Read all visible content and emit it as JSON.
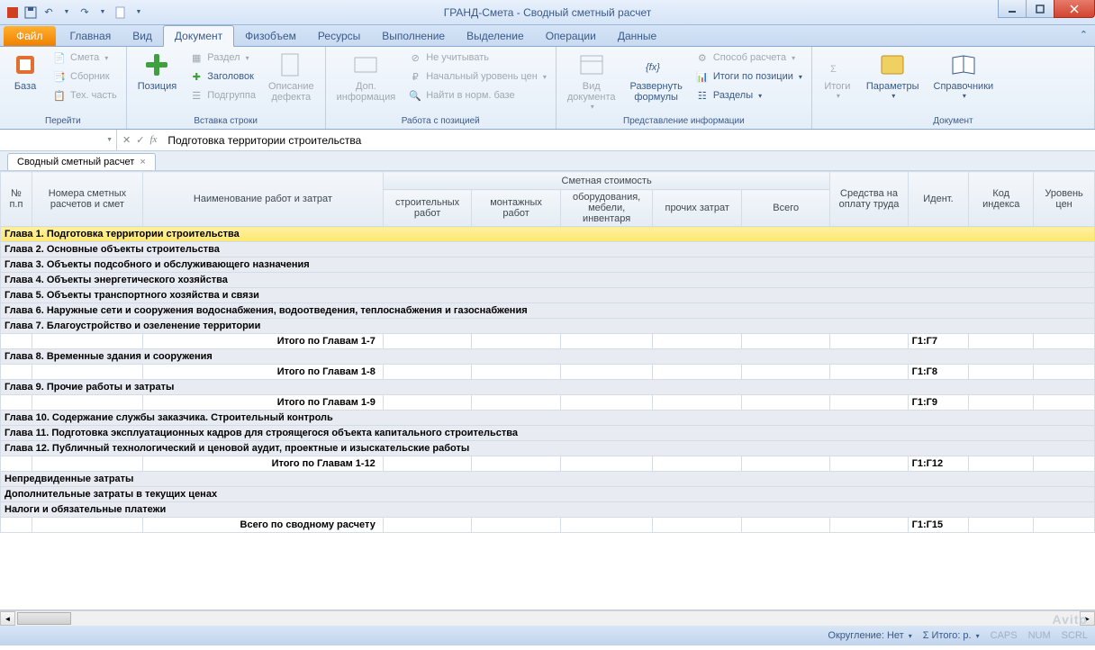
{
  "window": {
    "title": "ГРАНД-Смета - Сводный сметный расчет"
  },
  "qat": {
    "items": [
      "app",
      "save",
      "undo",
      "redo",
      "new",
      "dd"
    ]
  },
  "tabs": {
    "file": "Файл",
    "items": [
      "Главная",
      "Вид",
      "Документ",
      "Физобъем",
      "Ресурсы",
      "Выполнение",
      "Выделение",
      "Операции",
      "Данные"
    ],
    "active": 2
  },
  "ribbon": {
    "groups": [
      {
        "label": "Перейти",
        "big": [
          {
            "name": "baza",
            "label": "База"
          }
        ],
        "small": [
          {
            "name": "smeta",
            "label": "Смета",
            "dd": true,
            "disabled": true
          },
          {
            "name": "sbornik",
            "label": "Сборник",
            "disabled": true
          },
          {
            "name": "tehchast",
            "label": "Тех. часть",
            "disabled": true
          }
        ]
      },
      {
        "label": "Вставка строки",
        "big": [
          {
            "name": "pozitsiya",
            "label": "Позиция"
          }
        ],
        "small": [
          {
            "name": "razdel",
            "label": "Раздел",
            "dd": true,
            "disabled": true
          },
          {
            "name": "zagolovok",
            "label": "Заголовок"
          },
          {
            "name": "podgruppa",
            "label": "Подгруппа",
            "disabled": true
          }
        ],
        "big2": [
          {
            "name": "opisanie-defekta",
            "label": "Описание\nдефекта",
            "disabled": true
          }
        ]
      },
      {
        "label": "Работа с позицией",
        "big": [
          {
            "name": "dop-info",
            "label": "Доп.\nинформация",
            "disabled": true
          }
        ],
        "small": [
          {
            "name": "ne-uchityvat",
            "label": "Не учитывать",
            "disabled": true
          },
          {
            "name": "nach-uroven",
            "label": "Начальный уровень цен",
            "dd": true,
            "disabled": true
          },
          {
            "name": "naiti-v-baze",
            "label": "Найти в норм. базе",
            "disabled": true
          }
        ]
      },
      {
        "label": "Представление информации",
        "big": [
          {
            "name": "vid-dokumenta",
            "label": "Вид\nдокумента",
            "dd": true,
            "disabled": true
          },
          {
            "name": "razvernut",
            "label": "Развернуть\nформулы"
          }
        ],
        "small": [
          {
            "name": "sposob-rascheta",
            "label": "Способ расчета",
            "dd": true,
            "disabled": true
          },
          {
            "name": "itogi-po-pozitsii",
            "label": "Итоги по позиции",
            "dd": true
          },
          {
            "name": "razdely",
            "label": "Разделы",
            "dd": true
          }
        ]
      },
      {
        "label": "Документ",
        "big": [
          {
            "name": "itogi",
            "label": "Итоги",
            "dd": true,
            "disabled": true
          },
          {
            "name": "parametry",
            "label": "Параметры",
            "dd": true
          },
          {
            "name": "spravochniki",
            "label": "Справочники",
            "dd": true
          }
        ]
      }
    ]
  },
  "formula": {
    "value": "Подготовка территории строительства",
    "fx": "fx"
  },
  "ws_tab": {
    "label": "Сводный сметный расчет"
  },
  "columns": {
    "top": [
      "№\nп.п",
      "Номера сметных\nрасчетов и смет",
      "Наименование работ и затрат",
      "Сметная стоимость",
      "Средства на\nоплату труда",
      "Идент.",
      "Код\nиндекса",
      "Уровень\nцен"
    ],
    "sub": [
      "строительных\nработ",
      "монтажных работ",
      "оборудования,\nмебели, инвентаря",
      "прочих затрат",
      "Всего"
    ]
  },
  "rows": [
    {
      "type": "chapter",
      "selected": true,
      "text": "Глава 1. Подготовка территории строительства"
    },
    {
      "type": "chapter",
      "text": "Глава 2. Основные объекты строительства"
    },
    {
      "type": "chapter",
      "text": "Глава 3. Объекты подсобного и обслуживающего назначения"
    },
    {
      "type": "chapter",
      "text": "Глава 4. Объекты энергетического хозяйства"
    },
    {
      "type": "chapter",
      "text": "Глава 5. Объекты транспортного хозяйства и связи"
    },
    {
      "type": "chapter",
      "text": "Глава 6. Наружные сети и сооружения водоснабжения, водоотведения, теплоснабжения и газоснабжения"
    },
    {
      "type": "chapter",
      "text": "Глава 7. Благоустройство и озеленение территории"
    },
    {
      "type": "total",
      "name": "Итого по Главам 1-7",
      "ident": "Г1:Г7"
    },
    {
      "type": "chapter",
      "text": "Глава 8. Временные здания и сооружения"
    },
    {
      "type": "total",
      "name": "Итого по Главам 1-8",
      "ident": "Г1:Г8"
    },
    {
      "type": "chapter",
      "text": "Глава 9. Прочие работы и затраты"
    },
    {
      "type": "total",
      "name": "Итого по Главам 1-9",
      "ident": "Г1:Г9"
    },
    {
      "type": "chapter",
      "text": "Глава 10. Содержание службы заказчика. Строительный контроль"
    },
    {
      "type": "chapter",
      "text": "Глава 11. Подготовка эксплуатационных кадров для строящегося объекта капитального строительства"
    },
    {
      "type": "chapter",
      "text": "Глава 12. Публичный технологический и ценовой аудит, проектные и изыскательские работы"
    },
    {
      "type": "total",
      "name": "Итого по Главам 1-12",
      "ident": "Г1:Г12"
    },
    {
      "type": "chapter",
      "text": "Непредвиденные затраты"
    },
    {
      "type": "chapter",
      "text": "Дополнительные затраты в текущих ценах"
    },
    {
      "type": "chapter",
      "text": "Налоги и обязательные платежи"
    },
    {
      "type": "total",
      "name": "Всего по сводному расчету",
      "ident": "Г1:Г15"
    }
  ],
  "status": {
    "rounding_label": "Округление:",
    "rounding_value": "Нет",
    "sum_icon": "Σ",
    "sum_label": "Итого:",
    "sum_value": "р.",
    "caps": "CAPS",
    "num": "NUM",
    "scrl": "SCRL"
  },
  "watermark": "Avito"
}
